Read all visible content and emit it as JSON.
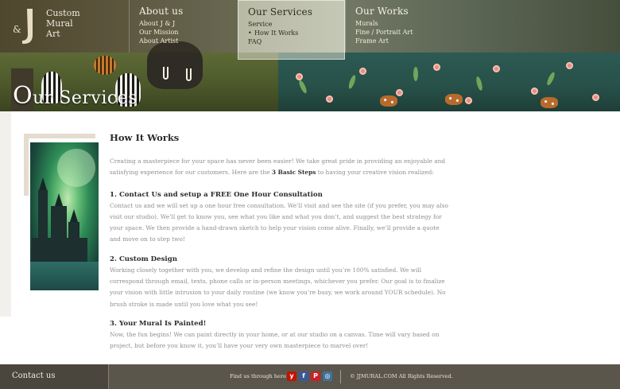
{
  "logo": {
    "initials_j1": "J",
    "ampersand": "&",
    "line1": "Custom",
    "line2": "Mural",
    "line3": "Art"
  },
  "nav": {
    "about": {
      "heading": "About us",
      "items": [
        "About J & J",
        "Our Mission",
        "About Artist"
      ]
    },
    "services": {
      "heading": "Our Services",
      "items": [
        "Service",
        "How It Works",
        "FAQ"
      ],
      "active": "How It Works"
    },
    "works": {
      "heading": "Our Works",
      "items": [
        "Murals",
        "Fine / Portrait Art",
        "Frame Art"
      ]
    }
  },
  "section_title": {
    "first_letter": "O",
    "rest": "ur Services"
  },
  "content": {
    "heading": "How It Works",
    "intro_part1": "Creating a masterpiece for your space has never been easier! We take great pride in providing an enjoyable and satisfying experience for our customers. Here are the ",
    "intro_bold": "3 Basic Steps",
    "intro_part2": " to having your creative vision realized:",
    "steps": [
      {
        "title": "1. Contact Us and setup a FREE One Hour Consultation",
        "text": "Contact us and we will set up a one hour free consultation. We’ll visit and see the site (if you prefer, you may also visit our studio). We’ll get to know you, see what you like and what you don’t, and suggest the best strategy for your space. We then provide a hand-drawn sketch to help your vision come alive. Finally, we’ll provide a quote and move on to step two!"
      },
      {
        "title": "2. Custom Design",
        "text": "Working closely together with you, we develop and refine the design until you’re 100% satisfied. We will correspond through email, texts, phone calls or in-person meetings, whichever you prefer. Our goal is to finalize your vision with little intrusion to your daily routine (we know you’re busy, we work around YOUR schedule). No brush stroke is made until you love what you see!"
      },
      {
        "title": "3. Your Mural Is Painted!",
        "text": "Now, the fun begins! We can paint directly in your home, or at our studio on a canvas. Time will vary based on project, but before you know it, you’ll have your very own masterpiece to marvel over!"
      }
    ]
  },
  "footer": {
    "contact": "Contact us",
    "find_us": "Find us through here",
    "social": [
      {
        "icon": "yelp-icon",
        "glyph": "y",
        "color": "#c41200"
      },
      {
        "icon": "facebook-icon",
        "glyph": "f",
        "color": "#3b5998"
      },
      {
        "icon": "pinterest-icon",
        "glyph": "P",
        "color": "#cb2027"
      },
      {
        "icon": "instagram-icon",
        "glyph": "◎",
        "color": "#3f729b"
      }
    ],
    "copyright": "© JJMURAL.COM All Rights Reserved."
  }
}
